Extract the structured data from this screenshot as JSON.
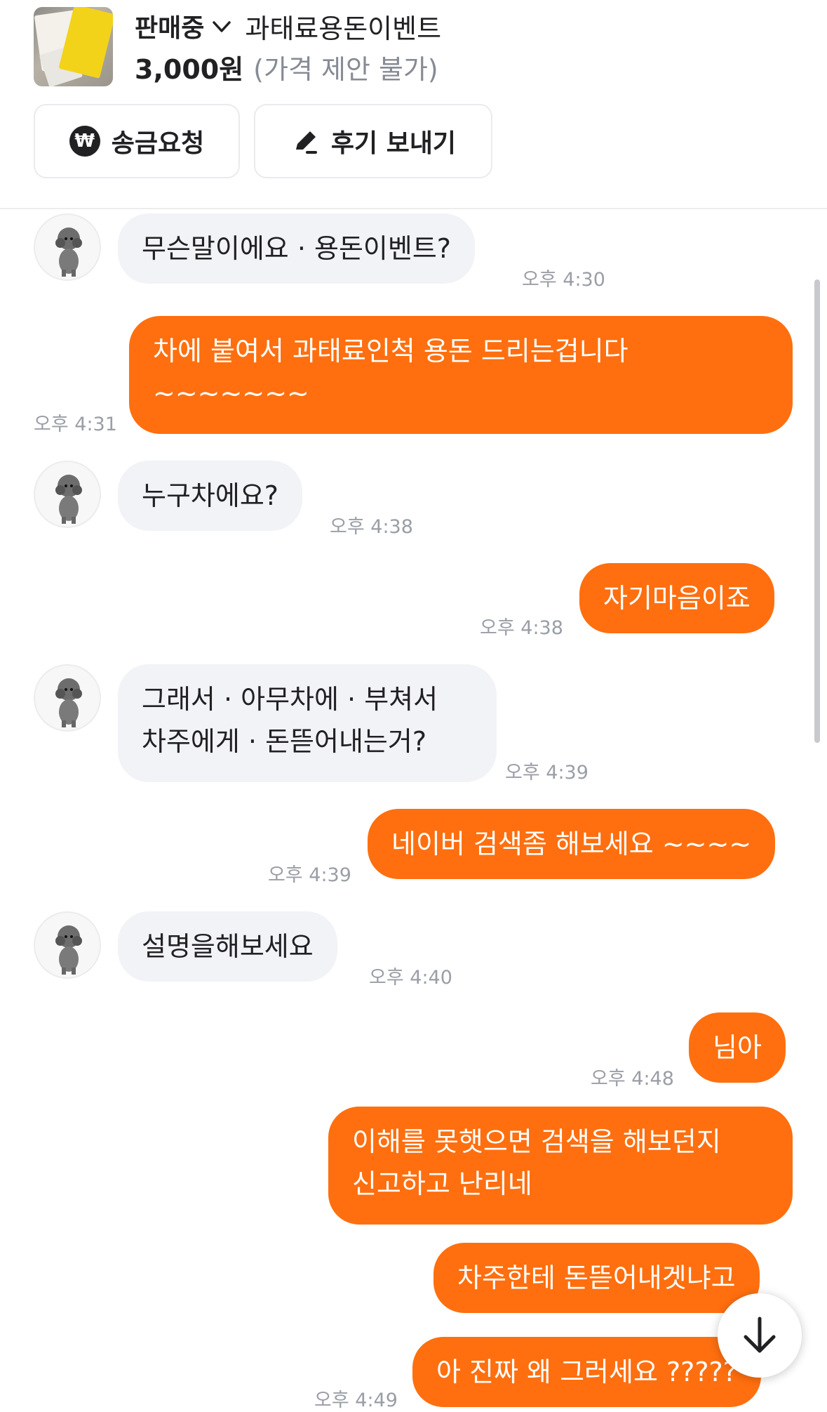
{
  "product": {
    "status": "판매중",
    "title": "과태료용돈이벤트",
    "price": "3,000원",
    "price_note": "(가격 제안 불가)"
  },
  "actions": {
    "remit_label": "송금요청",
    "review_label": "후기 보내기"
  },
  "messages": [
    {
      "from": "other",
      "text": "무슨말이에요 · 용돈이벤트?",
      "time": "오후 4:30"
    },
    {
      "from": "me",
      "lines": [
        "차에 붙여서 과태료인척 용돈 드리는겁니다",
        "~~~~~~~"
      ],
      "time": "오후 4:31"
    },
    {
      "from": "other",
      "text": "누구차에요?",
      "time": "오후 4:38"
    },
    {
      "from": "me",
      "text": "자기마음이죠",
      "time": "오후 4:38"
    },
    {
      "from": "other",
      "lines": [
        "그래서 · 아무차에 · 부쳐서",
        "차주에게 · 돈뜯어내는거?"
      ],
      "time": "오후 4:39"
    },
    {
      "from": "me",
      "text": "네이버 검색좀 해보세요 ~~~~",
      "time": "오후 4:39"
    },
    {
      "from": "other",
      "text": "설명을해보세요",
      "time": "오후 4:40"
    },
    {
      "from": "me",
      "text": "님아",
      "time": "오후 4:48"
    },
    {
      "from": "me",
      "lines": [
        "이해를 못햇으면 검색을 해보던지",
        "신고하고 난리네"
      ],
      "time": ""
    },
    {
      "from": "me",
      "text": "차주한테 돈뜯어내겟냐고",
      "time": ""
    },
    {
      "from": "me",
      "text": "아 진짜 왜 그러세요 ?????",
      "time": "오후 4:49"
    }
  ],
  "icons": {
    "remit": "won-circle-icon",
    "review": "pencil-icon",
    "status_dropdown": "chevron-down-icon",
    "scroll_down": "arrow-down-icon"
  },
  "colors": {
    "outgoing_bubble": "#ff6f0f",
    "incoming_bubble": "#f2f3f6"
  }
}
